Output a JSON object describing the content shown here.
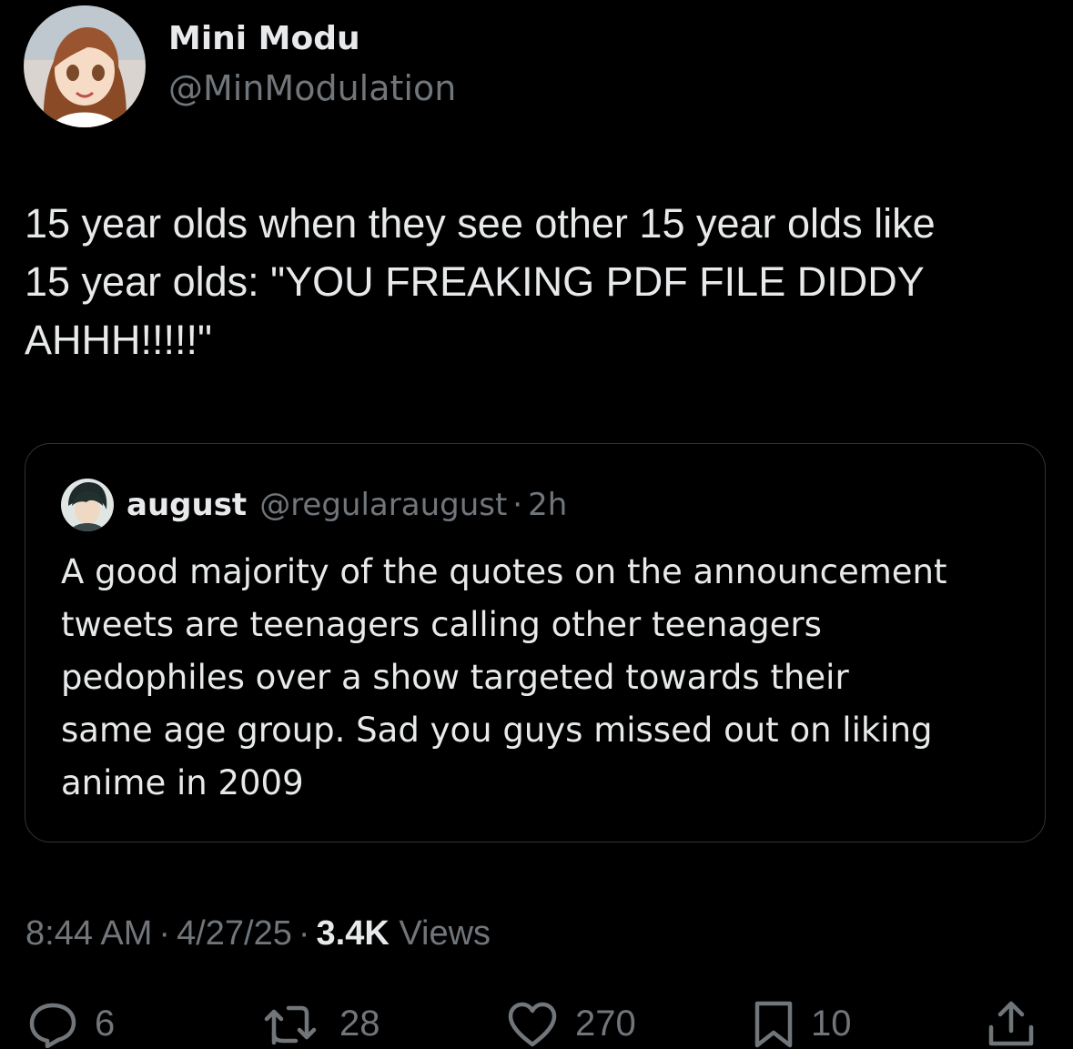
{
  "tweet": {
    "author": {
      "display_name": "Mini Modu",
      "handle": "@MinModulation"
    },
    "text_lines": [
      "15 year olds when they see other 15 year olds like",
      "15 year olds: \"YOU FREAKING PDF FILE DIDDY",
      "AHHH!!!!!\""
    ],
    "quote": {
      "display_name": "august",
      "handle": "@regularaugust",
      "separator": "·",
      "time": "2h",
      "text_lines": [
        "A good majority of the quotes on the announcement",
        "tweets are teenagers calling other teenagers",
        "pedophiles over a show targeted towards their",
        "same age group. Sad you guys missed out on liking",
        "anime in 2009"
      ]
    },
    "meta": {
      "time": "8:44 AM",
      "separator": "·",
      "date": "4/27/25",
      "views_count": "3.4K",
      "views_label": "Views"
    },
    "actions": {
      "replies": "6",
      "reposts": "28",
      "likes": "270",
      "bookmarks": "10"
    }
  },
  "icons": {
    "reply": "reply-icon",
    "repost": "repost-icon",
    "like": "heart-icon",
    "bookmark": "bookmark-icon",
    "share": "share-icon"
  },
  "colors": {
    "background": "#000000",
    "primary_text": "#e7e9ea",
    "secondary_text": "#71767b",
    "border": "#2f3336"
  }
}
